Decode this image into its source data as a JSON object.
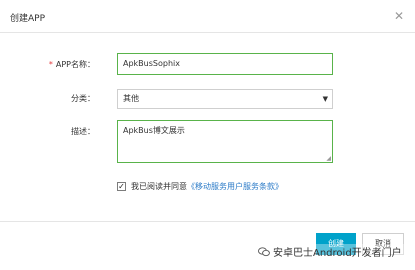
{
  "dialog": {
    "title": "创建APP",
    "close_icon": "close-icon",
    "close_glyph": "✕"
  },
  "form": {
    "app_name": {
      "required_mark": "*",
      "label": "APP名称：",
      "value": "ApkBusSophix"
    },
    "category": {
      "label": "分类：",
      "selected": "其他",
      "arrow_glyph": "▼"
    },
    "description": {
      "label": "描述：",
      "value": "ApkBus博文展示",
      "grip_glyph": "◢"
    },
    "agreement": {
      "checked": true,
      "check_glyph": "✓",
      "text": "我已阅读并同意",
      "link": "《移动服务用户服务条款》"
    }
  },
  "buttons": {
    "create": "创建",
    "cancel": "取消"
  },
  "watermark": {
    "text": "安卓巴士Android开发者门户",
    "icon": "wechat-icon"
  },
  "colors": {
    "accent_green": "#59b34a",
    "primary_button": "#00a2ca",
    "link": "#2a7ac7",
    "required": "#e4393c"
  }
}
